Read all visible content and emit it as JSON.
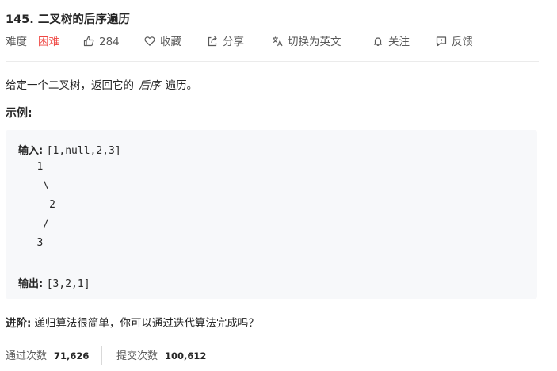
{
  "problem": {
    "title": "145. 二叉树的后序遍历",
    "difficulty_label": "难度",
    "difficulty_value": "困难",
    "likes": "284",
    "favorite_label": "收藏",
    "share_label": "分享",
    "switch_lang_label": "切换为英文",
    "follow_label": "关注",
    "feedback_label": "反馈"
  },
  "description": {
    "before": "给定一个二叉树，返回它的",
    "emphasis": "后序",
    "after": "遍历。"
  },
  "example": {
    "heading": "示例:",
    "input_label": "输入: ",
    "input_value": "[1,null,2,3]",
    "tree_lines": [
      "   1",
      "    \\",
      "     2",
      "    /",
      "   3"
    ],
    "output_label": "输出: ",
    "output_value": "[3,2,1]"
  },
  "advanced": {
    "label": "进阶:",
    "text": "递归算法很简单，你可以通过迭代算法完成吗？"
  },
  "stats": {
    "accepted_label": "通过次数",
    "accepted_value": "71,626",
    "submitted_label": "提交次数",
    "submitted_value": "100,612"
  },
  "colors": {
    "difficulty_hard": "#ef4743",
    "code_background": "#f7f8fa",
    "text": "#262626",
    "muted": "#595959"
  }
}
